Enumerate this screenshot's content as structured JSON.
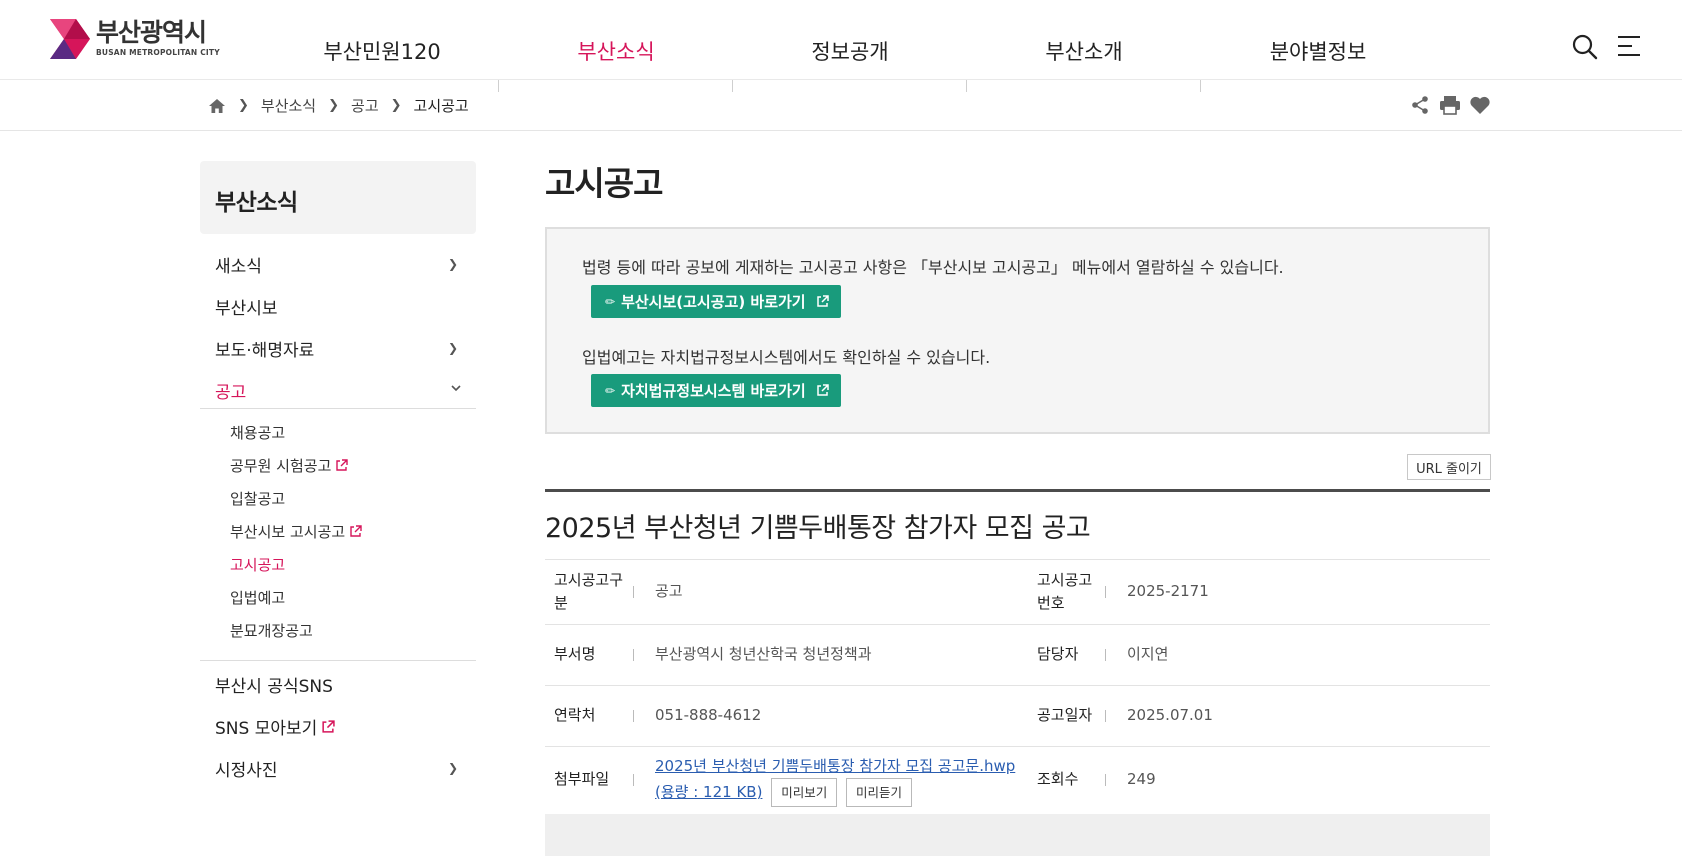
{
  "header": {
    "logo": {
      "name": "부산광역시",
      "sub": "BUSAN METROPOLITAN CITY"
    },
    "nav": [
      "부산민원120",
      "부산소식",
      "정보공개",
      "부산소개",
      "분야별정보"
    ],
    "active_nav": "부산소식",
    "icons": [
      "search-icon",
      "menu-icon"
    ]
  },
  "breadcrumb": {
    "home_icon": "home-icon",
    "items": [
      "부산소식",
      "공고",
      "고시공고"
    ],
    "tools": [
      "share-icon",
      "print-icon",
      "heart-icon"
    ]
  },
  "sidebar": {
    "title": "부산소식",
    "items": [
      "새소식",
      "부산시보",
      "보도·해명자료",
      "공고"
    ],
    "sub_items": [
      "채용공고",
      "공무원 시험공고",
      "입찰공고",
      "부산시보 고시공고",
      "고시공고",
      "입법예고",
      "분묘개장공고"
    ],
    "bottom_items": [
      "부산시 공식SNS",
      "SNS 모아보기",
      "시정사진"
    ]
  },
  "content": {
    "page_title": "고시공고",
    "notice": {
      "text1": "법령 등에 따라 공보에 게재하는 고시공고 사항은 「부산시보 고시공고」 메뉴에서 열람하실 수 있습니다.",
      "button1": "부산시보(고시공고) 바로가기",
      "text2": "입법예고는 자치법규정보시스템에서도 확인하실 수 있습니다.",
      "button2": "자치법규정보시스템 바로가기"
    },
    "url_button": "URL 줄이기",
    "post_title": "2025년 부산청년 기쁨두배통장 참가자 모집 공고",
    "info": {
      "category_label_1": "고시공고구",
      "category_label_2": "분",
      "category_value": "공고",
      "number_label_1": "고시공고",
      "number_label_2": "번호",
      "number_value": "2025-2171",
      "dept_label": "부서명",
      "dept_value": "부산광역시 청년산학국 청년정책과",
      "manager_label": "담당자",
      "manager_value": "이지연",
      "contact_label": "연락처",
      "contact_value": "051-888-4612",
      "date_label": "공고일자",
      "date_value": "2025.07.01",
      "file_label": "첨부파일",
      "file_name": "2025년 부산청년 기쁨두배통장 참가자 모집 공고문.hwp",
      "file_size": "(용량 : 121 KB)",
      "preview_button": "미리보기",
      "listen_button": "미리듣기",
      "views_label": "조회수",
      "views_value": "249"
    }
  },
  "colors": {
    "accent": "#d6155a",
    "button_green": "#199b7c"
  }
}
